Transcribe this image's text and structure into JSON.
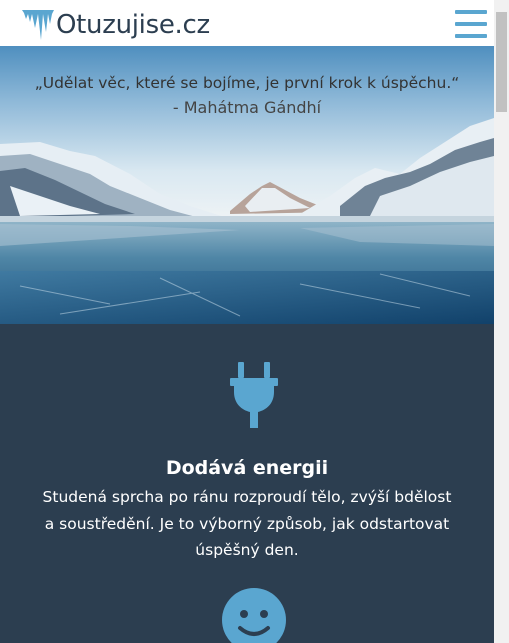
{
  "header": {
    "logo_text": "Otuzujise.cz",
    "logo_icon": "icicle-icon",
    "menu_icon": "hamburger-menu-icon"
  },
  "hero": {
    "quote": "„Udělat věc, které se bojíme, je první krok k úspěchu.“",
    "author": "- Mahátma Gándhí",
    "image": "frozen-lake-mountains"
  },
  "features": [
    {
      "icon": "plug-icon",
      "title": "Dodává energii",
      "description": "Studená sprcha po ránu rozproudí tělo, zvýší bdělost a soustředění. Je to výborný způsob, jak odstartovat úspěšný den."
    },
    {
      "icon": "smile-icon"
    }
  ],
  "colors": {
    "brand_blue": "#5aa6d0",
    "dark_section": "#2c3e50",
    "text_dark": "#2c3e50"
  }
}
